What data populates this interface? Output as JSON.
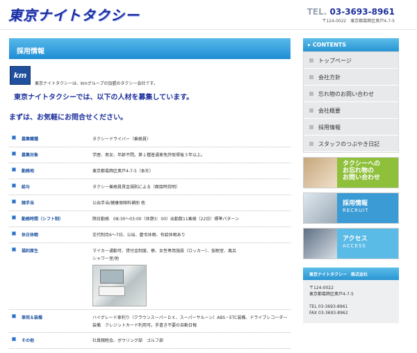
{
  "header": {
    "logo": "東京ナイトタクシー",
    "tel_prefix": "TEL.",
    "tel_number": "03-3693-8961",
    "address": "〒124-0022　東京都葛飾区奥戸4-7-5"
  },
  "main": {
    "title": "採用情報",
    "logo_text": "km",
    "intro": "東京ナイトタクシーは、Kmグループの加盟のタクシー会社です。",
    "headline1": "東京ナイトタクシーでは、以下の人材を募集しています。",
    "headline2": "まずは、お気軽にお問合せください。",
    "rows": [
      {
        "label": "募集職種",
        "value": "タクシードライバー（乗務員）"
      },
      {
        "label": "募集対象",
        "value": "学歴、男女、年齢不問。第１種普通車免許取得後３年以上。"
      },
      {
        "label": "勤務地",
        "value": "東京都葛飾区奥戸4-7-5（本社）"
      },
      {
        "label": "給与",
        "value": "タクシー乗務員賃金規則による（面接時説明）"
      },
      {
        "label": "諸手当",
        "value": "公出手当/健康保険料補助 他"
      },
      {
        "label": "勤務時間（シフト制）",
        "value": "隔日勤務　08:30～03:00（休憩3：00）出勤数11乗務（22日）標準パターン"
      },
      {
        "label": "休日休暇",
        "value": "交代制月6～7日、公出、慶弔休暇、有給休暇あり"
      },
      {
        "label": "福利厚生",
        "value": "マイカー通勤可、貸付金制度、寮、女性専用施設（ロッカー）、仮眠室、風呂",
        "value2": "シャワー室/他"
      },
      {
        "label": "車両＆装備",
        "value": "ハイグレード車利り（クラウンスーパーＤＸ、スーパーサルーン）ABS・ETC装備、ドライブレコーダー装備　クレジットカード利用可。手書き不要の自動日報"
      },
      {
        "label": "その他",
        "value": "社員親睦会、ボウリング部　ゴルフ部"
      }
    ]
  },
  "sidebar": {
    "contents_label": "CONTENTS",
    "menu": [
      "トップページ",
      "会社方針",
      "忘れ物のお問い合わせ",
      "会社概要",
      "採用情報",
      "スタッフのつぶやき日記"
    ],
    "banners": [
      {
        "title": "タクシーへの\nお忘れ物の\nお問い合わせ",
        "sub": ""
      },
      {
        "title": "採用情報",
        "sub": "RECRUIT"
      },
      {
        "title": "アクセス",
        "sub": "ACCESS"
      }
    ],
    "company": {
      "head": "東京ナイトタクシー　株式会社",
      "zip": "〒124-0022",
      "address": "東京都葛飾区奥戸4-7-5",
      "tel": "TEL 03-3693-8961",
      "fax": "FAX 03-3693-8962"
    }
  },
  "colors": {
    "brand": "#1b2e9c",
    "accent": "#2a95d2",
    "green": "#8fc03c"
  }
}
